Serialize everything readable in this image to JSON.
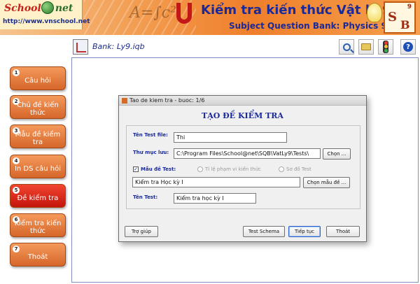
{
  "banner": {
    "logo_school": "School",
    "logo_net": "net",
    "url": "http://www.vnschool.net",
    "formula": "A=∫c²",
    "title": "Kiểm tra kiến thức Vật lý 9",
    "subtitle": "Subject Question Bank: Physics 9",
    "badge_s": "S",
    "badge_b": "B",
    "badge_num": "9"
  },
  "toolbar": {
    "bank_label": "Bank:  Ly9.iqb",
    "help_glyph": "?",
    "icons": [
      "bank-icon",
      "search-icon",
      "folder-icon",
      "traffic-light-icon",
      "help-icon"
    ]
  },
  "menu": {
    "items": [
      {
        "num": "1",
        "label": "Câu hỏi"
      },
      {
        "num": "2",
        "label": "Chủ đề kiến thức"
      },
      {
        "num": "3",
        "label": "Mẫu đề kiểm tra"
      },
      {
        "num": "4",
        "label": "In DS câu hỏi"
      },
      {
        "num": "5",
        "label": "Đề kiểm tra",
        "active": true
      },
      {
        "num": "6",
        "label": "Kiểm tra kiến thức"
      },
      {
        "num": "7",
        "label": "Thoát"
      }
    ]
  },
  "dialog": {
    "title": "Tao de kiem tra - buoc: 1/6",
    "heading": "TẠO ĐỀ KIỂM TRA",
    "test_file_label": "Tên Test file:",
    "test_file_value": "Thi",
    "folder_label": "Thư mục lưu:",
    "folder_value": "C:\\Program Files\\School@net\\SQB\\VatLy9\\Tests\\",
    "choose_folder_btn": "Chọn ...",
    "template_checkbox_label": "Mẫu đề Test:",
    "template_checked": "✓",
    "radio1_label": "Tỉ lệ phạm vi kiến thức",
    "radio2_label": "Sơ đồ Test",
    "template_value": "Kiểm tra Học kỳ I",
    "choose_template_btn": "Chọn mẫu đề ...",
    "test_name_label": "Tên Test:",
    "test_name_value": "Kiểm tra học kỳ I",
    "buttons": {
      "help": "Trợ giúp",
      "schema": "Test Schema",
      "next": "Tiếp tục",
      "exit": "Thoát"
    }
  },
  "colors": {
    "menu_button": "#e0743a",
    "menu_active": "#dd2a1c",
    "heading_blue": "#1a2a9a"
  }
}
